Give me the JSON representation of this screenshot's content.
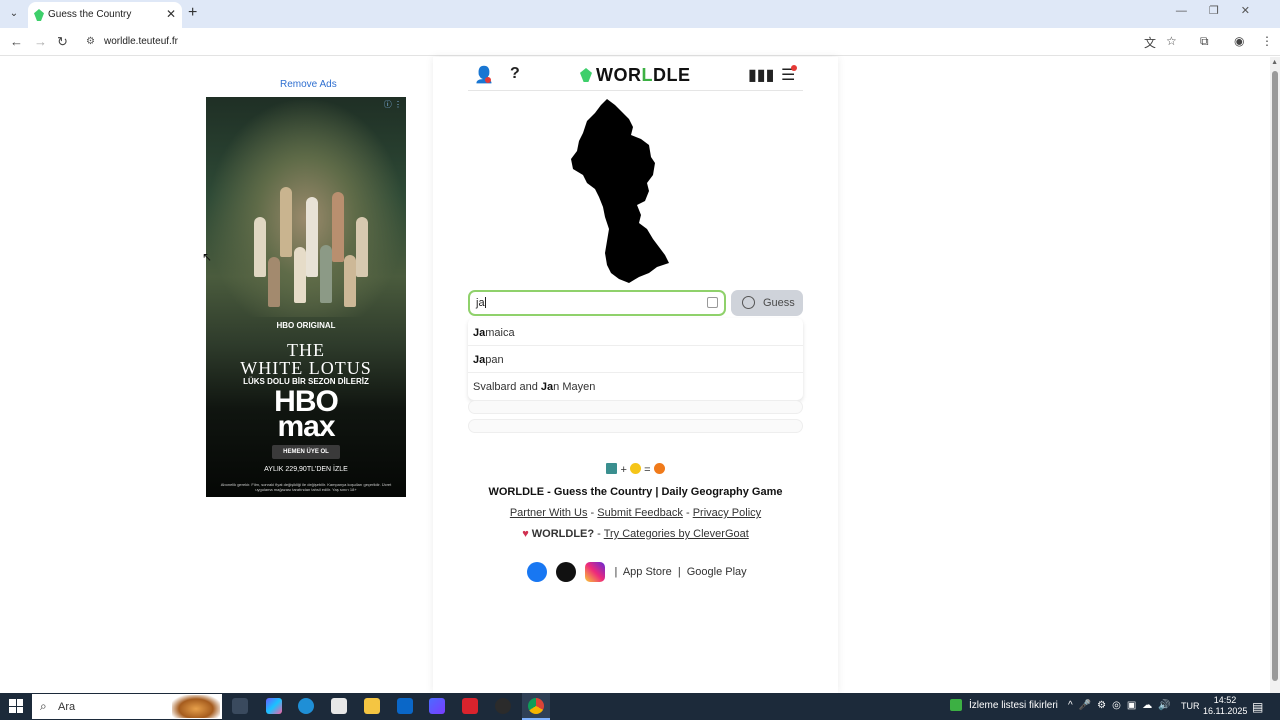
{
  "browser": {
    "tab_title": "Guess the Country",
    "tab_close": "✕",
    "new_tab": "+",
    "url": "worldle.teuteuf.fr",
    "window_controls": "—❐✕"
  },
  "page": {
    "remove_ads": "Remove Ads",
    "ad": {
      "adchoices": "ⓘ ⋮",
      "network_label": "HBO ORIGINAL",
      "title_line1": "THE",
      "title_line2": "WHITE LOTUS",
      "slogan": "LÜKS DOLU BİR SEZON DİLERİZ",
      "logo_line1": "HBO",
      "logo_line2": "max",
      "cta": "HEMEN ÜYE OL",
      "price": "AYLIK 229,90TL'DEN İZLE",
      "disclaimer": "Abonelik gerekir. Film, sonraki fiyat değişikliği ile değişebilir. Kampanya koşulları geçerlidir. Ücret uygulama mağazası tarafından tahsil edilir. Yaş sınırı 18+"
    },
    "header": {
      "logo_prefix": "WOR",
      "logo_green": "L",
      "logo_suffix": "DLE"
    },
    "guess": {
      "input_value": "ja",
      "button_label": "Guess"
    },
    "suggestions": [
      {
        "bold": "Ja",
        "rest": "maica"
      },
      {
        "bold": "Ja",
        "rest": "pan"
      },
      {
        "pre": "Svalbard and ",
        "bold": "Ja",
        "rest": "n Mayen"
      }
    ],
    "footer": {
      "plus": "+",
      "equals": "=",
      "title": "WORLDLE - Guess the Country | Daily Geography Game",
      "partner": "Partner With Us",
      "feedback": "Submit Feedback",
      "privacy": "Privacy Policy",
      "link_sep": "-",
      "brand": "WORLDLE?",
      "cats_sep": "-",
      "categories": "Try Categories by CleverGoat",
      "app_store": "App Store",
      "google_play": "Google Play",
      "pipe": "|"
    }
  },
  "taskbar": {
    "search_text": "Ara",
    "news": "İzleme listesi fikirleri",
    "lang": "TUR",
    "time": "14:52",
    "date": "16.11.2025"
  },
  "colors": {
    "accent_green": "#3cb043",
    "input_border": "#8fd16b",
    "guess_button": "#cfd3da",
    "tab_strip": "#dfe8f7",
    "taskbar": "#1c2a3a"
  },
  "icons": [
    "tab-menu-icon",
    "back-icon",
    "forward-icon",
    "reload-icon",
    "site-info-icon",
    "translate-icon",
    "star-icon",
    "extensions-icon",
    "profile-icon",
    "browser-menu-icon",
    "user-icon",
    "help-icon",
    "stats-icon",
    "menu-icon",
    "keyboard-icon",
    "globe-icon",
    "facebook-icon",
    "tiktok-icon",
    "instagram-icon",
    "heart-icon",
    "windows-start-icon",
    "search-icon"
  ]
}
